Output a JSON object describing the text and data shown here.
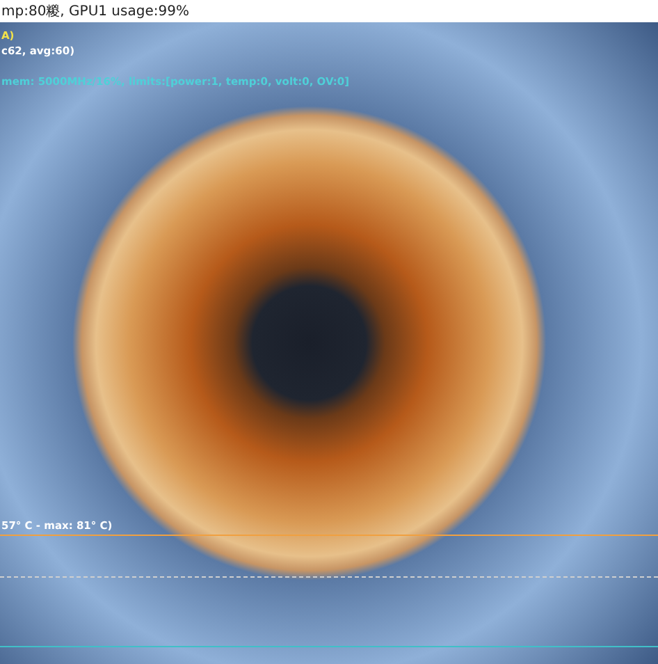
{
  "title_bar": {
    "text": "mp:80糉, GPU1 usage:99%"
  },
  "overlay_lines": [
    {
      "kind": "yellow",
      "text": "A)"
    },
    {
      "kind": "white",
      "text": "c62, avg:60)"
    },
    {
      "kind": "cyan",
      "text": "mem: 5000MHz/16%, limits:[power:1, temp:0, volt:0, OV:0]"
    }
  ],
  "graph": {
    "label": "57° C - max: 81° C)"
  }
}
